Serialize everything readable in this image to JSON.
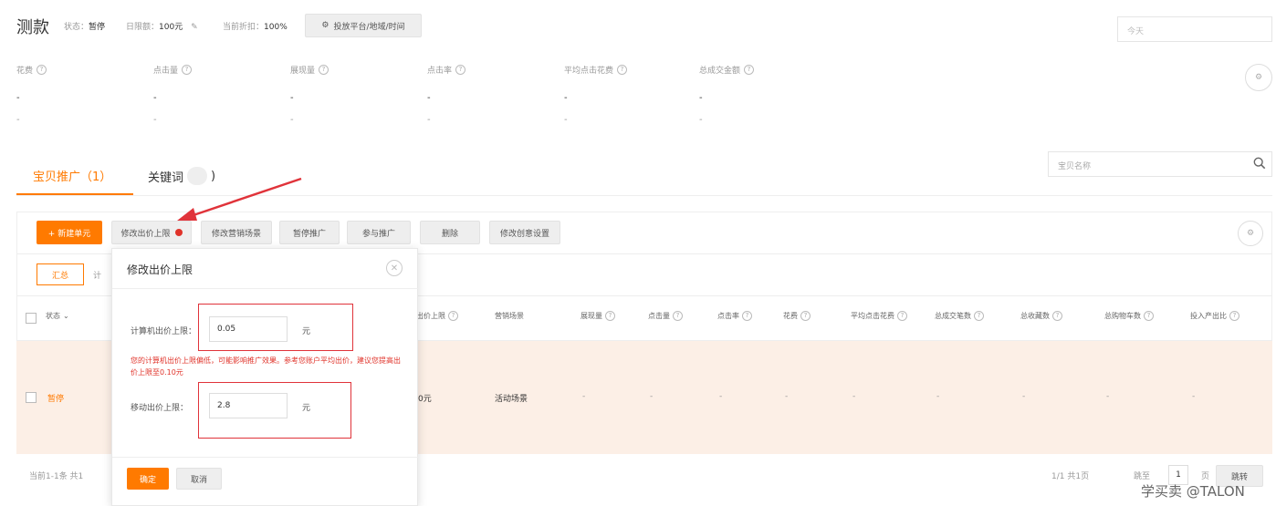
{
  "header": {
    "title": "测款",
    "status_label": "状态：",
    "status_value": "暂停",
    "budget_label": "日限额：",
    "budget_value": "100元",
    "discount_label": "当前折扣：",
    "discount_value": "100%",
    "schedule_button": "投放平台/地域/时间",
    "date_picker": "今天"
  },
  "metrics": [
    {
      "label": "花费",
      "value": "-",
      "sub": "-"
    },
    {
      "label": "点击量",
      "value": "-",
      "sub": "-"
    },
    {
      "label": "展现量",
      "value": "-",
      "sub": "-"
    },
    {
      "label": "点击率",
      "value": "-",
      "sub": "-"
    },
    {
      "label": "平均点击花费",
      "value": "-",
      "sub": "-"
    },
    {
      "label": "总成交金额",
      "value": "-",
      "sub": "-"
    }
  ],
  "tabs": {
    "active": "宝贝推广（1）",
    "keywords": "关键词",
    "keywords_close": ")"
  },
  "search": {
    "placeholder": "宝贝名称"
  },
  "toolbar": {
    "new_unit": "+ 新建单元",
    "modify_bid_limit": "修改出价上限",
    "modify_scene": "修改营销场景",
    "pause": "暂停推广",
    "join": "参与推广",
    "delete": "删除",
    "modify_creative": "修改创意设置"
  },
  "summary": {
    "label": "汇总",
    "next": "计"
  },
  "table": {
    "headers": [
      "状态",
      "出价上限",
      "营销场景",
      "展现量",
      "点击量",
      "点击率",
      "花费",
      "平均点击花费",
      "总成交笔数",
      "总收藏数",
      "总购物车数",
      "投入产出比"
    ],
    "row": {
      "status": "暂停",
      "bid": "0元",
      "scene": "活动场景",
      "dashes": [
        "-",
        "-",
        "-",
        "-",
        "-",
        "-",
        "-",
        "-",
        "-"
      ]
    }
  },
  "footer": {
    "count": "当前1-1条  共1",
    "pages": "1/1  共1页",
    "goto_label": "跳至",
    "goto_value": "1",
    "page_unit": "页",
    "jump": "跳转"
  },
  "popup": {
    "title": "修改出价上限",
    "pc_label": "计算机出价上限：",
    "pc_value": "0.05",
    "pc_unit": "元",
    "warning": "您的计算机出价上限偏低，可能影响推广效果。参考您账户平均出价，建议您提高出价上限至0.10元",
    "mobile_label": "移动出价上限：",
    "mobile_value": "2.8",
    "mobile_unit": "元",
    "confirm": "确定",
    "cancel": "取消"
  },
  "watermark": "学买卖 @TALON"
}
